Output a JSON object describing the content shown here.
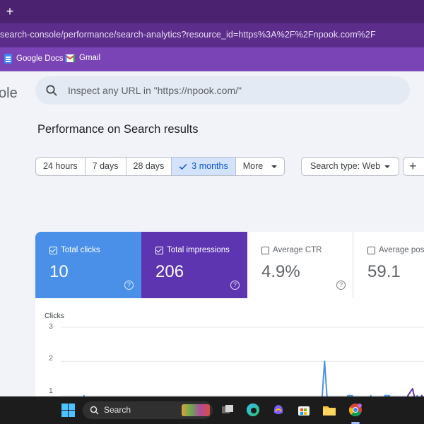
{
  "browser": {
    "new_tab_symbol": "+",
    "url": "search-console/performance/search-analytics?resource_id=https%3A%2F%2Fnpook.com%2F",
    "bookmarks": [
      {
        "label": "Google Docs",
        "icon": "google-docs-icon"
      },
      {
        "label": "Gmail",
        "icon": "gmail-icon"
      }
    ]
  },
  "app": {
    "logo_fragment": "ole",
    "search": {
      "placeholder": "Inspect any URL in \"https://npook.com/\"",
      "icon": "search-icon"
    },
    "page_title": "Performance on Search results"
  },
  "date_filters": {
    "options": [
      "24 hours",
      "7 days",
      "28 days",
      "3 months",
      "More"
    ],
    "selected": "3 months"
  },
  "filters": {
    "search_type": "Search type: Web",
    "add_symbol": "+"
  },
  "metrics": [
    {
      "label": "Total clicks",
      "value": "10",
      "checked": true,
      "color": "#4a90e8"
    },
    {
      "label": "Total impressions",
      "value": "206",
      "checked": true,
      "color": "#5e35b1"
    },
    {
      "label": "Average CTR",
      "value": "4.9%",
      "checked": false
    },
    {
      "label": "Average posi",
      "value": "59.1",
      "checked": false
    }
  ],
  "chart_data": {
    "type": "line",
    "title": "Clicks",
    "yticks": [
      "3",
      "2",
      "1"
    ],
    "ylim": [
      0,
      3
    ],
    "grid": true,
    "series": [
      {
        "color": "#4a90e8",
        "values": [
          0,
          0,
          0,
          0,
          0,
          1,
          0,
          0,
          0,
          0,
          0,
          0,
          0,
          0,
          0,
          0,
          0,
          0,
          0,
          0,
          0,
          0,
          0,
          0,
          0,
          0,
          0,
          0,
          0,
          0,
          0,
          0,
          0,
          0,
          0,
          0,
          0,
          0,
          0,
          0,
          0,
          0,
          0,
          0,
          0,
          0,
          0,
          0,
          0,
          0,
          0,
          0,
          0,
          0,
          0,
          0,
          0,
          2,
          0,
          0,
          0,
          0,
          1,
          1,
          0,
          0,
          0,
          1,
          0,
          0,
          1,
          1,
          0,
          0,
          0,
          1,
          0,
          1,
          0,
          0,
          0
        ]
      },
      {
        "color": "#5e35b1",
        "values": [
          0,
          0,
          0,
          0,
          0,
          0,
          0,
          0,
          0,
          0,
          0,
          0,
          0,
          0,
          0,
          0,
          0,
          0,
          0,
          0,
          0,
          0,
          0,
          0,
          0,
          0,
          0,
          0,
          0,
          0,
          0,
          0,
          0,
          0,
          0,
          0,
          0,
          0,
          0,
          0,
          0,
          0,
          0,
          0,
          0,
          0,
          0,
          0,
          0,
          0,
          0,
          0,
          0,
          0,
          0,
          0,
          0,
          0,
          0,
          0,
          0,
          0,
          0,
          0,
          0,
          0,
          0,
          0,
          0,
          0,
          0,
          0,
          0,
          0,
          0,
          1,
          1.2,
          0.6,
          1,
          0.3,
          0
        ]
      }
    ]
  },
  "taskbar": {
    "search_label": "Search",
    "apps": [
      "windows-start-icon",
      "task-view-icon",
      "edge-icon",
      "copilot-icon",
      "store-icon",
      "file-explorer-icon",
      "chrome-icon"
    ]
  }
}
